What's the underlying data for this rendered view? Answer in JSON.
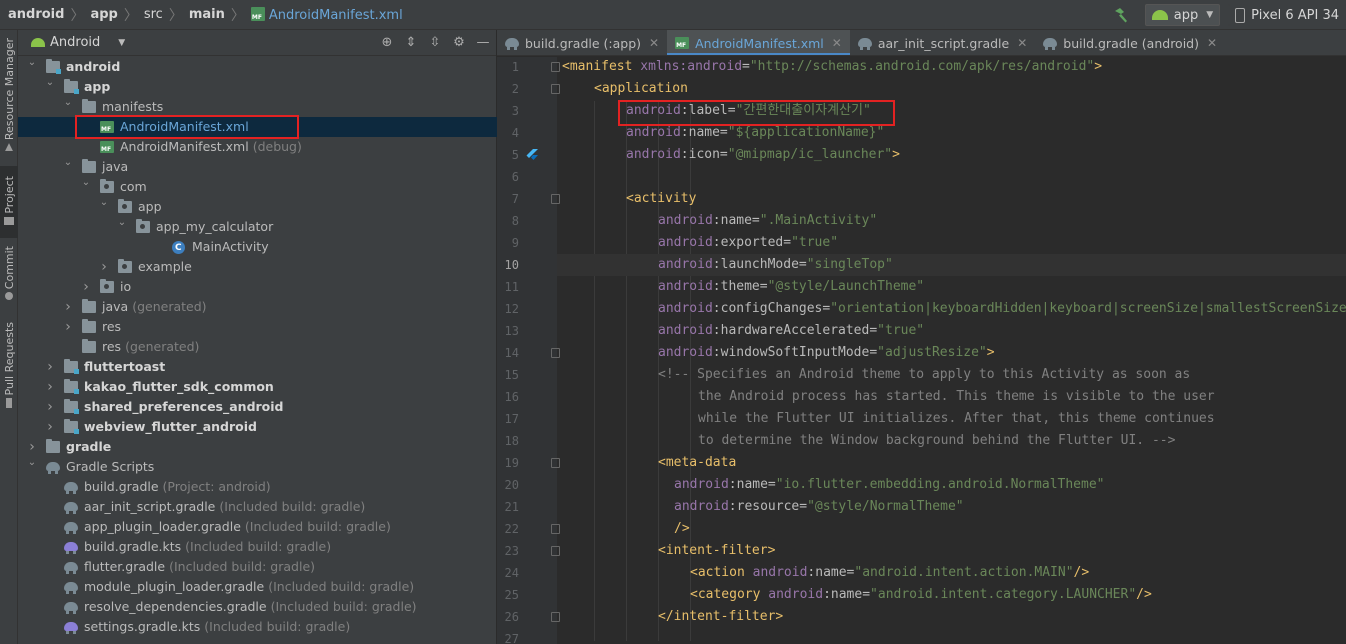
{
  "navbar": {
    "breadcrumb": [
      {
        "label": "android",
        "kind": "bold"
      },
      {
        "label": "app",
        "kind": "bold"
      },
      {
        "label": "src",
        "kind": "plain"
      },
      {
        "label": "main",
        "kind": "bold"
      },
      {
        "label": "AndroidManifest.xml",
        "kind": "file"
      }
    ],
    "run_config": "app",
    "device": "Pixel 6 API 34"
  },
  "toolstrip": {
    "tabs": [
      "Resource Manager",
      "Project",
      "Commit",
      "Pull Requests"
    ]
  },
  "project": {
    "view": "Android",
    "tree": [
      {
        "label": "android",
        "hint": "",
        "depth": 0,
        "icon": "module-folder",
        "expanded": true,
        "style": "strong"
      },
      {
        "label": "app",
        "hint": "",
        "depth": 1,
        "icon": "module-folder",
        "expanded": true,
        "style": "strong"
      },
      {
        "label": "manifests",
        "hint": "",
        "depth": 2,
        "icon": "folder",
        "expanded": true,
        "style": ""
      },
      {
        "label": "AndroidManifest.xml",
        "hint": "",
        "depth": 3,
        "icon": "xml-file",
        "expanded": null,
        "style": "blue",
        "selected": true
      },
      {
        "label": "AndroidManifest.xml",
        "hint": "(debug)",
        "depth": 3,
        "icon": "xml-file",
        "expanded": null,
        "style": ""
      },
      {
        "label": "java",
        "hint": "",
        "depth": 2,
        "icon": "folder",
        "expanded": true,
        "style": ""
      },
      {
        "label": "com",
        "hint": "",
        "depth": 3,
        "icon": "package-folder",
        "expanded": true,
        "style": ""
      },
      {
        "label": "app",
        "hint": "",
        "depth": 4,
        "icon": "package-folder",
        "expanded": true,
        "style": ""
      },
      {
        "label": "app_my_calculator",
        "hint": "",
        "depth": 5,
        "icon": "package-folder",
        "expanded": true,
        "style": ""
      },
      {
        "label": "MainActivity",
        "hint": "",
        "depth": 7,
        "icon": "class-file",
        "expanded": null,
        "style": ""
      },
      {
        "label": "example",
        "hint": "",
        "depth": 4,
        "icon": "package-folder",
        "expanded": false,
        "style": ""
      },
      {
        "label": "io",
        "hint": "",
        "depth": 3,
        "icon": "package-folder",
        "expanded": false,
        "style": ""
      },
      {
        "label": "java",
        "hint": "(generated)",
        "depth": 2,
        "icon": "folder",
        "expanded": false,
        "style": ""
      },
      {
        "label": "res",
        "hint": "",
        "depth": 2,
        "icon": "folder",
        "expanded": false,
        "style": ""
      },
      {
        "label": "res",
        "hint": "(generated)",
        "depth": 2,
        "icon": "folder",
        "expanded": null,
        "style": ""
      },
      {
        "label": "fluttertoast",
        "hint": "",
        "depth": 1,
        "icon": "module-folder",
        "expanded": false,
        "style": "strong"
      },
      {
        "label": "kakao_flutter_sdk_common",
        "hint": "",
        "depth": 1,
        "icon": "module-folder",
        "expanded": false,
        "style": "strong"
      },
      {
        "label": "shared_preferences_android",
        "hint": "",
        "depth": 1,
        "icon": "module-folder",
        "expanded": false,
        "style": "strong"
      },
      {
        "label": "webview_flutter_android",
        "hint": "",
        "depth": 1,
        "icon": "module-folder",
        "expanded": false,
        "style": "strong"
      },
      {
        "label": "gradle",
        "hint": "",
        "depth": 0,
        "icon": "folder",
        "expanded": false,
        "style": "strong"
      },
      {
        "label": "Gradle Scripts",
        "hint": "",
        "depth": 0,
        "icon": "gradle",
        "expanded": true,
        "style": ""
      },
      {
        "label": "build.gradle",
        "hint": "(Project: android)",
        "depth": 1,
        "icon": "gradle",
        "expanded": null,
        "style": ""
      },
      {
        "label": "aar_init_script.gradle",
        "hint": "(Included build: gradle)",
        "depth": 1,
        "icon": "gradle",
        "expanded": null,
        "style": ""
      },
      {
        "label": "app_plugin_loader.gradle",
        "hint": "(Included build: gradle)",
        "depth": 1,
        "icon": "gradle",
        "expanded": null,
        "style": ""
      },
      {
        "label": "build.gradle.kts",
        "hint": "(Included build: gradle)",
        "depth": 1,
        "icon": "gradle-kts",
        "expanded": null,
        "style": ""
      },
      {
        "label": "flutter.gradle",
        "hint": "(Included build: gradle)",
        "depth": 1,
        "icon": "gradle",
        "expanded": null,
        "style": ""
      },
      {
        "label": "module_plugin_loader.gradle",
        "hint": "(Included build: gradle)",
        "depth": 1,
        "icon": "gradle",
        "expanded": null,
        "style": ""
      },
      {
        "label": "resolve_dependencies.gradle",
        "hint": "(Included build: gradle)",
        "depth": 1,
        "icon": "gradle",
        "expanded": null,
        "style": ""
      },
      {
        "label": "settings.gradle.kts",
        "hint": "(Included build: gradle)",
        "depth": 1,
        "icon": "gradle-kts",
        "expanded": null,
        "style": ""
      }
    ]
  },
  "editor": {
    "tabs": [
      {
        "label": "build.gradle (:app)",
        "icon": "gradle",
        "active": false
      },
      {
        "label": "AndroidManifest.xml",
        "icon": "xml-file",
        "active": true
      },
      {
        "label": "aar_init_script.gradle",
        "icon": "gradle",
        "active": false
      },
      {
        "label": "build.gradle (android)",
        "icon": "gradle",
        "active": false
      }
    ],
    "current_line": 10,
    "lines": [
      {
        "n": "1",
        "indent": 0,
        "t": [
          [
            "tg",
            "<manifest "
          ],
          [
            "an",
            "xmlns:android"
          ],
          [
            "at",
            "="
          ],
          [
            "av",
            "\"http://schemas.android.com/apk/res/android\""
          ],
          [
            "tg",
            ">"
          ]
        ]
      },
      {
        "n": "2",
        "indent": 4,
        "t": [
          [
            "tg",
            "<application"
          ]
        ]
      },
      {
        "n": "3",
        "indent": 8,
        "t": [
          [
            "an",
            "android"
          ],
          [
            "at",
            ":label="
          ],
          [
            "av",
            "\"간편한대출이자계산기\""
          ]
        ]
      },
      {
        "n": "4",
        "indent": 8,
        "t": [
          [
            "an",
            "android"
          ],
          [
            "at",
            ":name="
          ],
          [
            "av",
            "\"${applicationName}\""
          ]
        ]
      },
      {
        "n": "5",
        "indent": 8,
        "t": [
          [
            "an",
            "android"
          ],
          [
            "at",
            ":icon="
          ],
          [
            "av",
            "\"@mipmap/ic_launcher\""
          ],
          [
            "tg",
            ">"
          ]
        ]
      },
      {
        "n": "6",
        "indent": 0,
        "t": []
      },
      {
        "n": "7",
        "indent": 8,
        "t": [
          [
            "tg",
            "<activity"
          ]
        ]
      },
      {
        "n": "8",
        "indent": 12,
        "t": [
          [
            "an",
            "android"
          ],
          [
            "at",
            ":name="
          ],
          [
            "av",
            "\".MainActivity\""
          ]
        ]
      },
      {
        "n": "9",
        "indent": 12,
        "t": [
          [
            "an",
            "android"
          ],
          [
            "at",
            ":exported="
          ],
          [
            "av",
            "\"true\""
          ]
        ]
      },
      {
        "n": "10",
        "indent": 12,
        "t": [
          [
            "an",
            "android"
          ],
          [
            "at",
            ":launchMode="
          ],
          [
            "av",
            "\"singleTop\""
          ]
        ]
      },
      {
        "n": "11",
        "indent": 12,
        "t": [
          [
            "an",
            "android"
          ],
          [
            "at",
            ":theme="
          ],
          [
            "av",
            "\"@style/LaunchTheme\""
          ]
        ]
      },
      {
        "n": "12",
        "indent": 12,
        "t": [
          [
            "an",
            "android"
          ],
          [
            "at",
            ":configChanges="
          ],
          [
            "av",
            "\"orientation|keyboardHidden|keyboard|screenSize|smallestScreenSize|locale|layoutDirection|fontScale|screenLayout|density|uiMode\""
          ]
        ]
      },
      {
        "n": "13",
        "indent": 12,
        "t": [
          [
            "an",
            "android"
          ],
          [
            "at",
            ":hardwareAccelerated="
          ],
          [
            "av",
            "\"true\""
          ]
        ]
      },
      {
        "n": "14",
        "indent": 12,
        "t": [
          [
            "an",
            "android"
          ],
          [
            "at",
            ":windowSoftInputMode="
          ],
          [
            "av",
            "\"adjustResize\""
          ],
          [
            "tg",
            ">"
          ]
        ]
      },
      {
        "n": "15",
        "indent": 12,
        "t": [
          [
            "cm",
            "<!-- Specifies an Android theme to apply to this Activity as soon as"
          ]
        ]
      },
      {
        "n": "16",
        "indent": 17,
        "t": [
          [
            "cm",
            "the Android process has started. This theme is visible to the user"
          ]
        ]
      },
      {
        "n": "17",
        "indent": 17,
        "t": [
          [
            "cm",
            "while the Flutter UI initializes. After that, this theme continues"
          ]
        ]
      },
      {
        "n": "18",
        "indent": 17,
        "t": [
          [
            "cm",
            "to determine the Window background behind the Flutter UI. -->"
          ]
        ]
      },
      {
        "n": "19",
        "indent": 12,
        "t": [
          [
            "tg",
            "<meta-data"
          ]
        ]
      },
      {
        "n": "20",
        "indent": 14,
        "t": [
          [
            "an",
            "android"
          ],
          [
            "at",
            ":name="
          ],
          [
            "av",
            "\"io.flutter.embedding.android.NormalTheme\""
          ]
        ]
      },
      {
        "n": "21",
        "indent": 14,
        "t": [
          [
            "an",
            "android"
          ],
          [
            "at",
            ":resource="
          ],
          [
            "av",
            "\"@style/NormalTheme\""
          ]
        ]
      },
      {
        "n": "22",
        "indent": 14,
        "t": [
          [
            "tg",
            "/>"
          ]
        ]
      },
      {
        "n": "23",
        "indent": 12,
        "t": [
          [
            "tg",
            "<intent-filter>"
          ]
        ]
      },
      {
        "n": "24",
        "indent": 16,
        "t": [
          [
            "tg",
            "<action "
          ],
          [
            "an",
            "android"
          ],
          [
            "at",
            ":name="
          ],
          [
            "av",
            "\"android.intent.action.MAIN\""
          ],
          [
            "tg",
            "/>"
          ]
        ]
      },
      {
        "n": "25",
        "indent": 16,
        "t": [
          [
            "tg",
            "<category "
          ],
          [
            "an",
            "android"
          ],
          [
            "at",
            ":name="
          ],
          [
            "av",
            "\"android.intent.category.LAUNCHER\""
          ],
          [
            "tg",
            "/>"
          ]
        ]
      },
      {
        "n": "26",
        "indent": 12,
        "t": [
          [
            "tg",
            "</intent-filter>"
          ]
        ]
      },
      {
        "n": "27",
        "indent": 0,
        "t": []
      }
    ]
  }
}
